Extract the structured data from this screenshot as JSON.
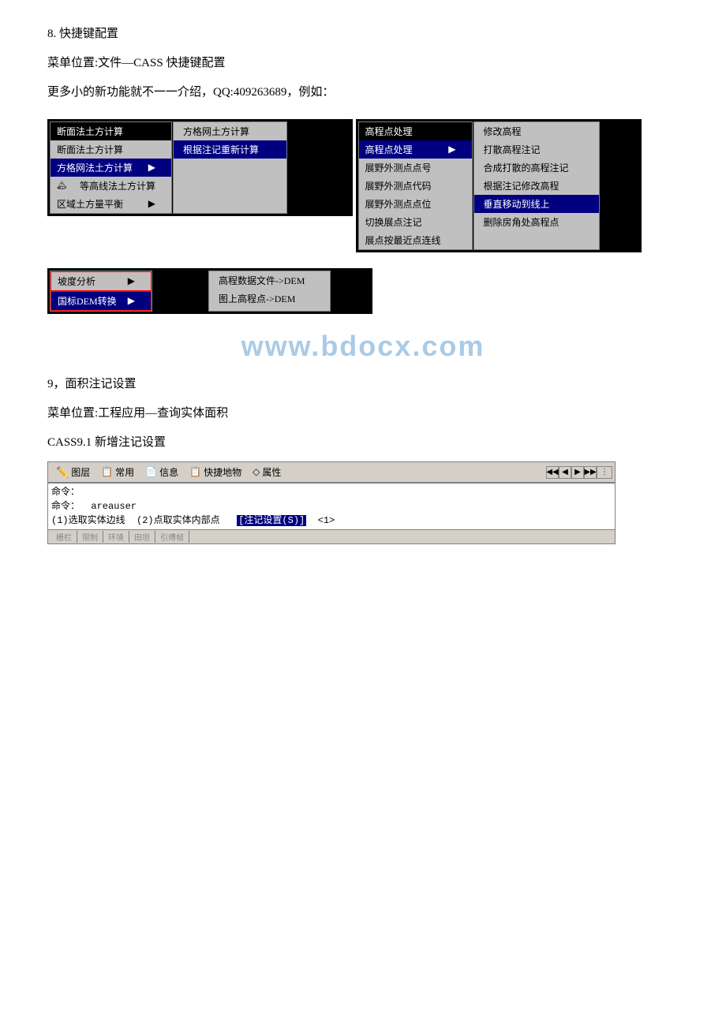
{
  "page": {
    "section8_title": "8. 快捷键配置",
    "section8_menu_location": "菜单位置:文件—CASS 快捷键配置",
    "section8_note": "更多小的新功能就不一一介绍，QQ:409263689，例如：",
    "section9_title": "9，面积注记设置",
    "section9_menu_location": "菜单位置:工程应用—查询实体面积",
    "section9_note": "CASS9.1 新增注记设置",
    "watermark": "www.bdocx.com"
  },
  "menu1": {
    "header": "断面法土方计算",
    "items": [
      {
        "label": "断面法土方计算",
        "selected": false,
        "has_arrow": false
      },
      {
        "label": "方格网法土方计算",
        "selected": true,
        "has_arrow": true
      },
      {
        "label": "等高线法土方计算",
        "selected": false,
        "has_arrow": false,
        "has_icon": true
      },
      {
        "label": "区域土方量平衡",
        "selected": false,
        "has_arrow": true
      }
    ],
    "submenu": [
      {
        "label": "方格网土方计算",
        "selected": false
      },
      {
        "label": "根据注记重新计算",
        "selected": true
      }
    ]
  },
  "menu2": {
    "header": "高程点处理",
    "items": [
      {
        "label": "高程点处理",
        "selected": true,
        "has_arrow": true
      },
      {
        "label": "展野外测点点号",
        "selected": false
      },
      {
        "label": "展野外测点代码",
        "selected": false
      },
      {
        "label": "展野外测点点位",
        "selected": false
      },
      {
        "label": "切换展点注记",
        "selected": false
      },
      {
        "label": "展点按最近点连线",
        "selected": false
      }
    ],
    "submenu": [
      {
        "label": "修改高程",
        "selected": false
      },
      {
        "label": "打散高程注记",
        "selected": false
      },
      {
        "label": "合成打散的高程注记",
        "selected": false
      },
      {
        "label": "根据注记修改高程",
        "selected": false
      },
      {
        "label": "垂直移动到线上",
        "selected": true
      },
      {
        "label": "删除房角处高程点",
        "selected": false
      }
    ]
  },
  "menu3": {
    "items": [
      {
        "label": "坡度分析",
        "selected": false,
        "has_arrow": true,
        "red_border": true
      },
      {
        "label": "国标DEM转换",
        "selected": true,
        "has_arrow": true,
        "red_border": true
      }
    ],
    "submenu": [
      {
        "label": "高程数据文件->DEM",
        "selected": false
      },
      {
        "label": "图上高程点->DEM",
        "selected": false
      }
    ]
  },
  "cad": {
    "toolbar_tabs": [
      {
        "icon": "✏️",
        "label": "图层"
      },
      {
        "icon": "📋",
        "label": "常用"
      },
      {
        "icon": "📄",
        "label": "信息"
      },
      {
        "icon": "📋",
        "label": "快捷地物"
      },
      {
        "icon": "◇",
        "label": "属性"
      }
    ],
    "command_lines": [
      "命令：",
      "命令：  areauser",
      "(1)选取实体边线  (2)点取实体内部点  [注记设置(S)] <1>"
    ],
    "cmd_highlight": "[注记设置(S)]",
    "status_items": [
      "栅栏",
      "限制",
      "环境",
      "田坦",
      "引傅帧"
    ]
  }
}
